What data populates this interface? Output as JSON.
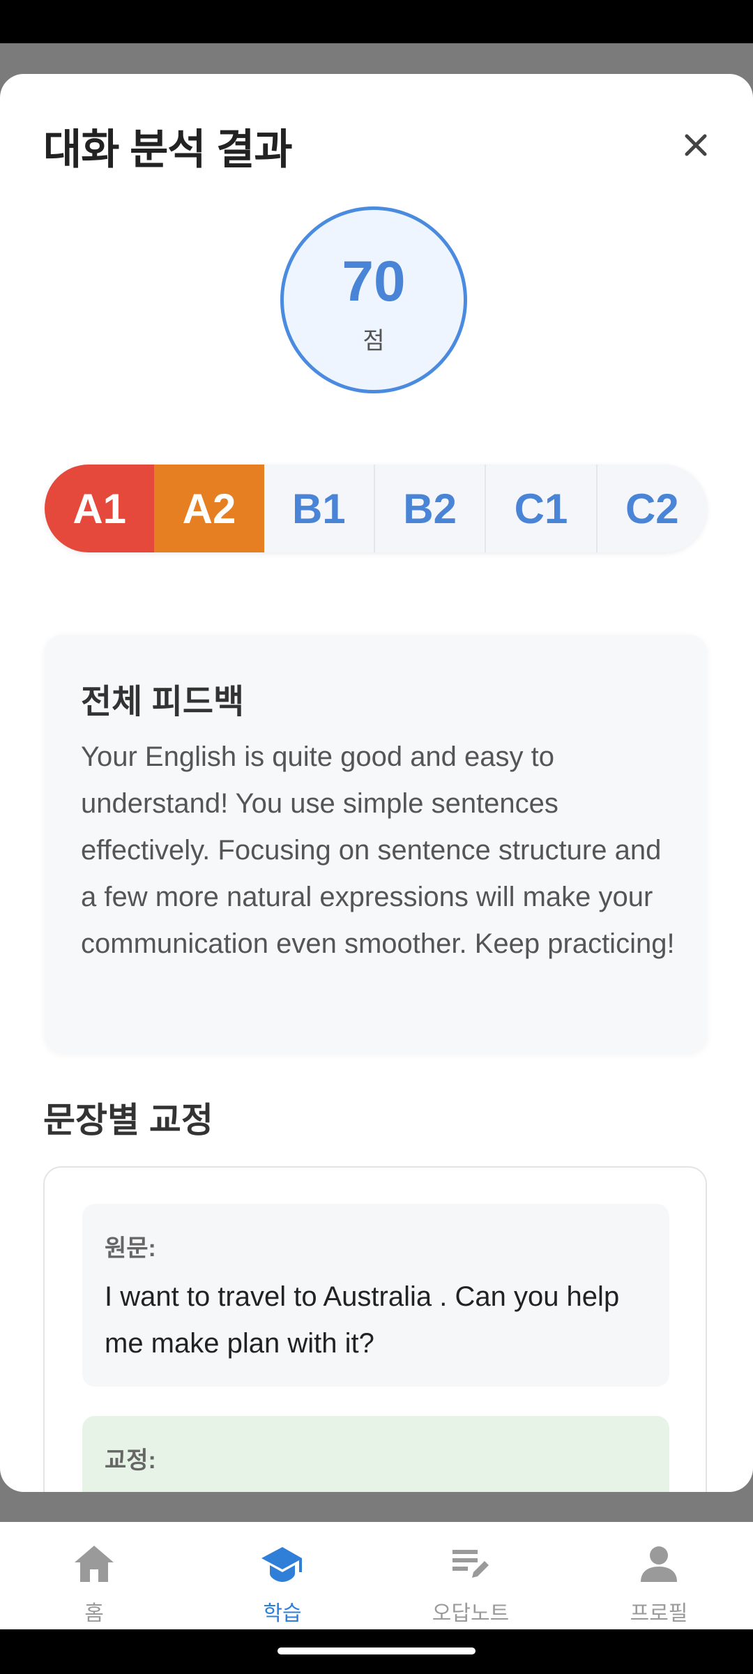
{
  "modal": {
    "title": "대화 분석 결과",
    "close_icon": "close-icon",
    "score": {
      "value": "70",
      "unit": "점"
    },
    "levels": [
      {
        "label": "A1",
        "state": "reached",
        "color": "#e5493c"
      },
      {
        "label": "A2",
        "state": "current",
        "color": "#e67e22"
      },
      {
        "label": "B1",
        "state": "inactive"
      },
      {
        "label": "B2",
        "state": "inactive"
      },
      {
        "label": "C1",
        "state": "inactive"
      },
      {
        "label": "C2",
        "state": "inactive"
      }
    ],
    "feedback": {
      "title": "전체 피드백",
      "text": "Your English is quite good and easy to understand! You use simple sentences effectively. Focusing on sentence structure and a few more natural expressions will make your communication even smoother. Keep practicing!"
    },
    "corrections_title": "문장별 교정",
    "corrections": [
      {
        "original_label": "원문:",
        "original": "I want to travel to Australia . Can you help me make plan with it?",
        "corrected_label": "교정:"
      }
    ]
  },
  "bottom_nav": [
    {
      "label": "홈",
      "icon": "home-icon",
      "active": false
    },
    {
      "label": "학습",
      "icon": "graduation-cap-icon",
      "active": true
    },
    {
      "label": "오답노트",
      "icon": "notes-edit-icon",
      "active": false
    },
    {
      "label": "프로필",
      "icon": "person-icon",
      "active": false
    }
  ],
  "colors": {
    "accent": "#2f7fd9",
    "score_blue": "#4a84d6",
    "corrected_bg": "#e6f3e6"
  }
}
